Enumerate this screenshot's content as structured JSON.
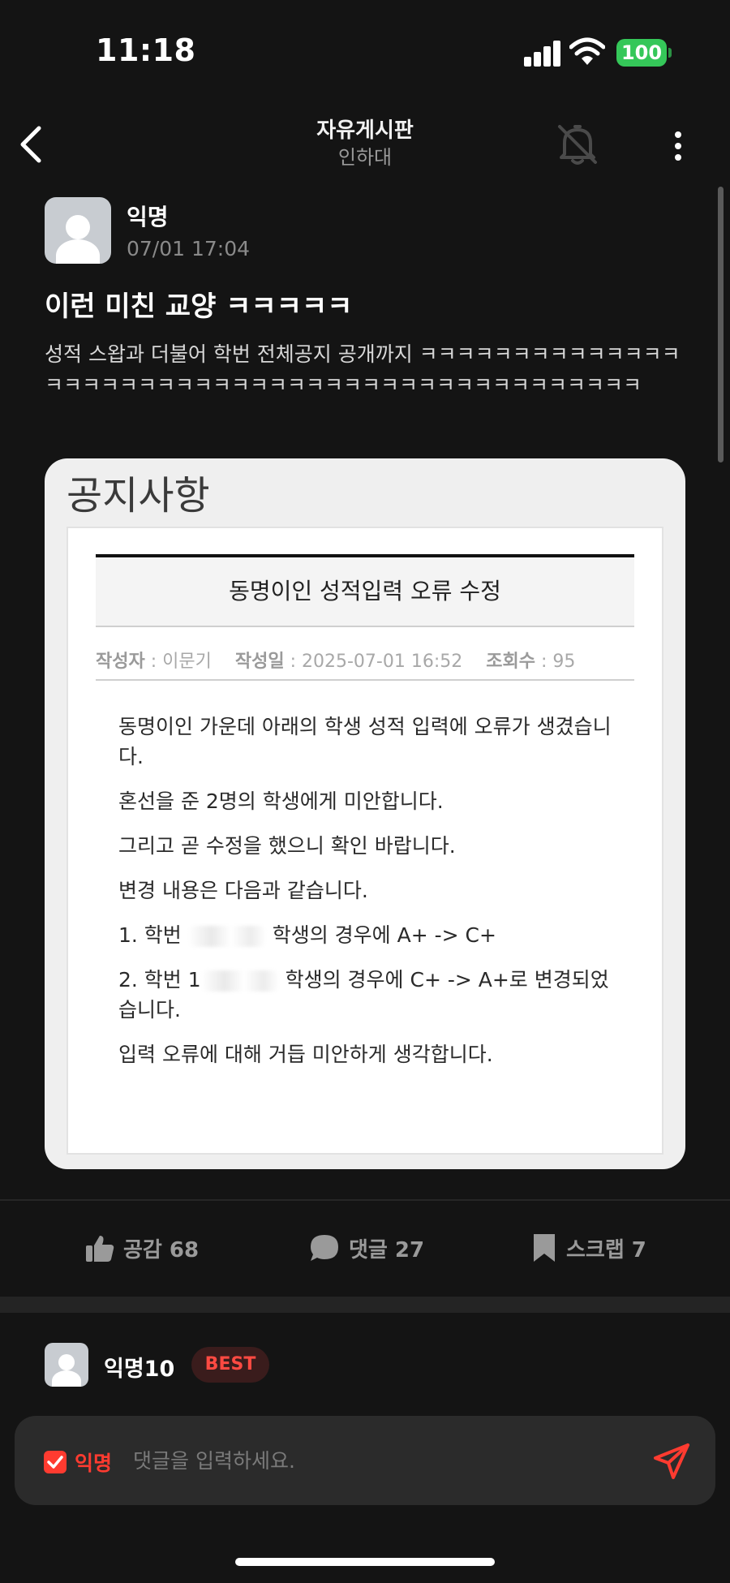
{
  "status_bar": {
    "time": "11:18",
    "battery": "100",
    "battery_color": "#35c759"
  },
  "nav": {
    "title": "자유게시판",
    "subtitle": "인하대"
  },
  "post": {
    "author": "익명",
    "date": "07/01 17:04",
    "title": "이런 미친 교양 ㅋㅋㅋㅋㅋ",
    "body": "성적 스왑과 더불어 학번 전체공지 공개까지 ㅋㅋㅋㅋㅋㅋㅋㅋㅋㅋㅋㅋㅋㅋㅋㅋㅋㅋㅋㅋㅋㅋㅋㅋㅋㅋㅋㅋㅋㅋㅋㅋㅋㅋㅋㅋㅋㅋㅋㅋㅋㅋㅋㅋㅋㅋ"
  },
  "notice": {
    "heading": "공지사항",
    "title": "동명이인 성적입력 오류 수정",
    "meta": {
      "author_label": "작성자",
      "author": " : 이문기",
      "date_label": "작성일",
      "date": " : 2025-07-01 16:52",
      "views_label": "조회수",
      "views": " : 95"
    },
    "lines": {
      "l1": "동명이인 가운데 아래의 학생 성적 입력에 오류가 생겼습니다.",
      "l2": "혼선을 준 2명의 학생에게 미안합니다.",
      "l3": "그리고 곧 수정을 했으니 확인 바랍니다.",
      "l4": "변경 내용은 다음과 같습니다.",
      "l5_prefix": "1. 학번 ",
      "l5_suffix": " 학생의 경우에 A+ -> C+",
      "l6_prefix": "2. 학번 1",
      "l6_suffix": " 학생의 경우에 C+ -> A+로 변경되었습니다.",
      "l7": "입력 오류에 대해 거듭 미안하게 생각합니다."
    }
  },
  "reactions": {
    "like": "공감 68",
    "comment": "댓글 27",
    "scrap": "스크랩 7"
  },
  "comment_preview": {
    "author": "익명10",
    "badge": "BEST"
  },
  "comment_input": {
    "anonymous_label": "익명",
    "placeholder": "댓글을 입력하세요.",
    "accent_color": "#ff3b30"
  },
  "icons": [
    "back-arrow-icon",
    "bell-off-icon",
    "more-vert-icon",
    "thumbs-up-icon",
    "comment-bubble-icon",
    "bookmark-icon",
    "checkbox-checked-icon",
    "send-icon"
  ]
}
